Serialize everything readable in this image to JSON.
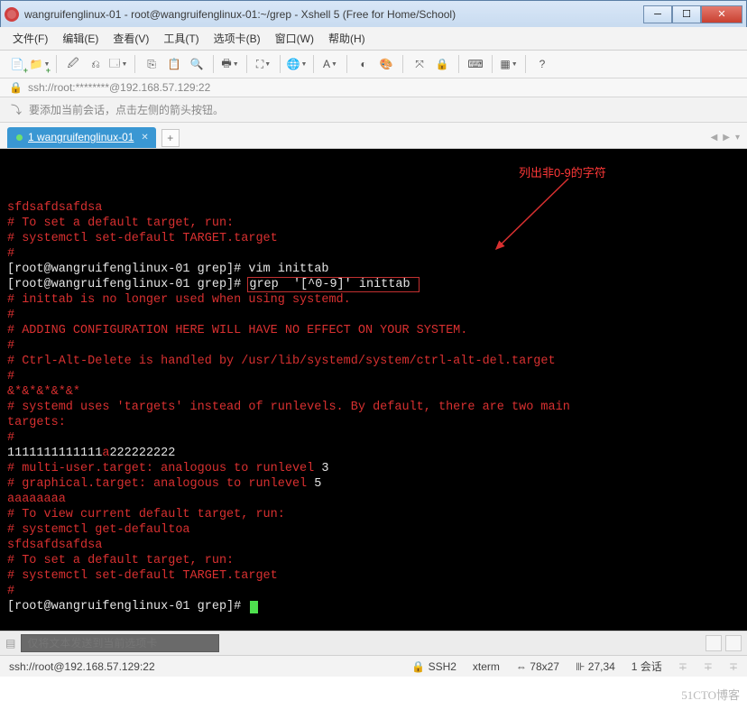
{
  "window": {
    "title": "wangruifenglinux-01 - root@wangruifenglinux-01:~/grep - Xshell 5 (Free for Home/School)"
  },
  "menus": [
    "文件(F)",
    "编辑(E)",
    "查看(V)",
    "工具(T)",
    "选项卡(B)",
    "窗口(W)",
    "帮助(H)"
  ],
  "toolbar_icons": [
    "new-session-icon",
    "open-icon",
    "sep",
    "reconnect-icon",
    "disconnect-icon",
    "properties-icon",
    "sep",
    "copy-icon",
    "paste-icon",
    "find-icon",
    "sep",
    "print-icon",
    "sep",
    "fullscreen-icon",
    "sep",
    "globe-icon",
    "sep",
    "font-icon",
    "sep",
    "color-scheme-icon",
    "palette-icon",
    "sep",
    "broadcast-icon",
    "lock-icon",
    "sep",
    "keyboard-icon",
    "sep",
    "layout-icon",
    "sep",
    "help-icon"
  ],
  "address": "ssh://root:********@192.168.57.129:22",
  "hint": "要添加当前会话，点击左侧的箭头按钮。",
  "tab": {
    "label": "1 wangruifenglinux-01"
  },
  "annotation": "列出非0-9的字符",
  "terminal_lines": [
    {
      "cls": "t-red",
      "text": "sfdsafdsafdsa"
    },
    {
      "cls": "t-red",
      "text": "# To set a default target, run:"
    },
    {
      "cls": "t-red",
      "text": "# systemctl set-default TARGET.target"
    },
    {
      "cls": "t-red",
      "text": "#"
    },
    {
      "cls": "mixed",
      "segs": [
        {
          "cls": "t-white",
          "text": "[root@wangruifenglinux-01 grep]# vim inittab"
        }
      ]
    },
    {
      "cls": "mixed",
      "segs": [
        {
          "cls": "t-white",
          "text": "[root@wangruifenglinux-01 grep]# "
        },
        {
          "cls": "t-white boxed",
          "text": "grep  '[^0-9]' inittab "
        }
      ]
    },
    {
      "cls": "t-red",
      "text": "# inittab is no longer used when using systemd."
    },
    {
      "cls": "t-red",
      "text": "#"
    },
    {
      "cls": "t-red",
      "text": "# ADDING CONFIGURATION HERE WILL HAVE NO EFFECT ON YOUR SYSTEM."
    },
    {
      "cls": "t-red",
      "text": "#"
    },
    {
      "cls": "t-red",
      "text": "# Ctrl-Alt-Delete is handled by /usr/lib/systemd/system/ctrl-alt-del.target"
    },
    {
      "cls": "t-red",
      "text": "#"
    },
    {
      "cls": "t-red",
      "text": "&*&*&*&*&*"
    },
    {
      "cls": "t-red",
      "text": "# systemd uses 'targets' instead of runlevels. By default, there are two main"
    },
    {
      "cls": "t-red",
      "text": "targets:"
    },
    {
      "cls": "t-red",
      "text": "#"
    },
    {
      "cls": "mixed",
      "segs": [
        {
          "cls": "t-white",
          "text": "1111111111111"
        },
        {
          "cls": "t-red",
          "text": "a"
        },
        {
          "cls": "t-white",
          "text": "222222222"
        }
      ]
    },
    {
      "cls": "mixed",
      "segs": [
        {
          "cls": "t-red",
          "text": "# multi-user.target: analogous to runlevel "
        },
        {
          "cls": "t-white",
          "text": "3"
        }
      ]
    },
    {
      "cls": "mixed",
      "segs": [
        {
          "cls": "t-red",
          "text": "# graphical.target: analogous to runlevel "
        },
        {
          "cls": "t-white",
          "text": "5"
        }
      ]
    },
    {
      "cls": "t-red",
      "text": "aaaaaaaa"
    },
    {
      "cls": "t-red",
      "text": "# To view current default target, run:"
    },
    {
      "cls": "t-red",
      "text": "# systemctl get-defaultoa"
    },
    {
      "cls": "t-red",
      "text": "sfdsafdsafdsa"
    },
    {
      "cls": "t-red",
      "text": "# To set a default target, run:"
    },
    {
      "cls": "t-red",
      "text": "# systemctl set-default TARGET.target"
    },
    {
      "cls": "t-red",
      "text": "#"
    },
    {
      "cls": "prompt",
      "segs": [
        {
          "cls": "t-white",
          "text": "[root@wangruifenglinux-01 grep]# "
        }
      ],
      "cursor": true
    }
  ],
  "send_placeholder": "仅将文本发送到当前选项卡",
  "status": {
    "left": "ssh://root@192.168.57.129:22",
    "ssh": "SSH2",
    "term": "xterm",
    "size": "78x27",
    "pos": "27,34",
    "sess": "1 会话"
  },
  "watermark": "51CTO博客"
}
